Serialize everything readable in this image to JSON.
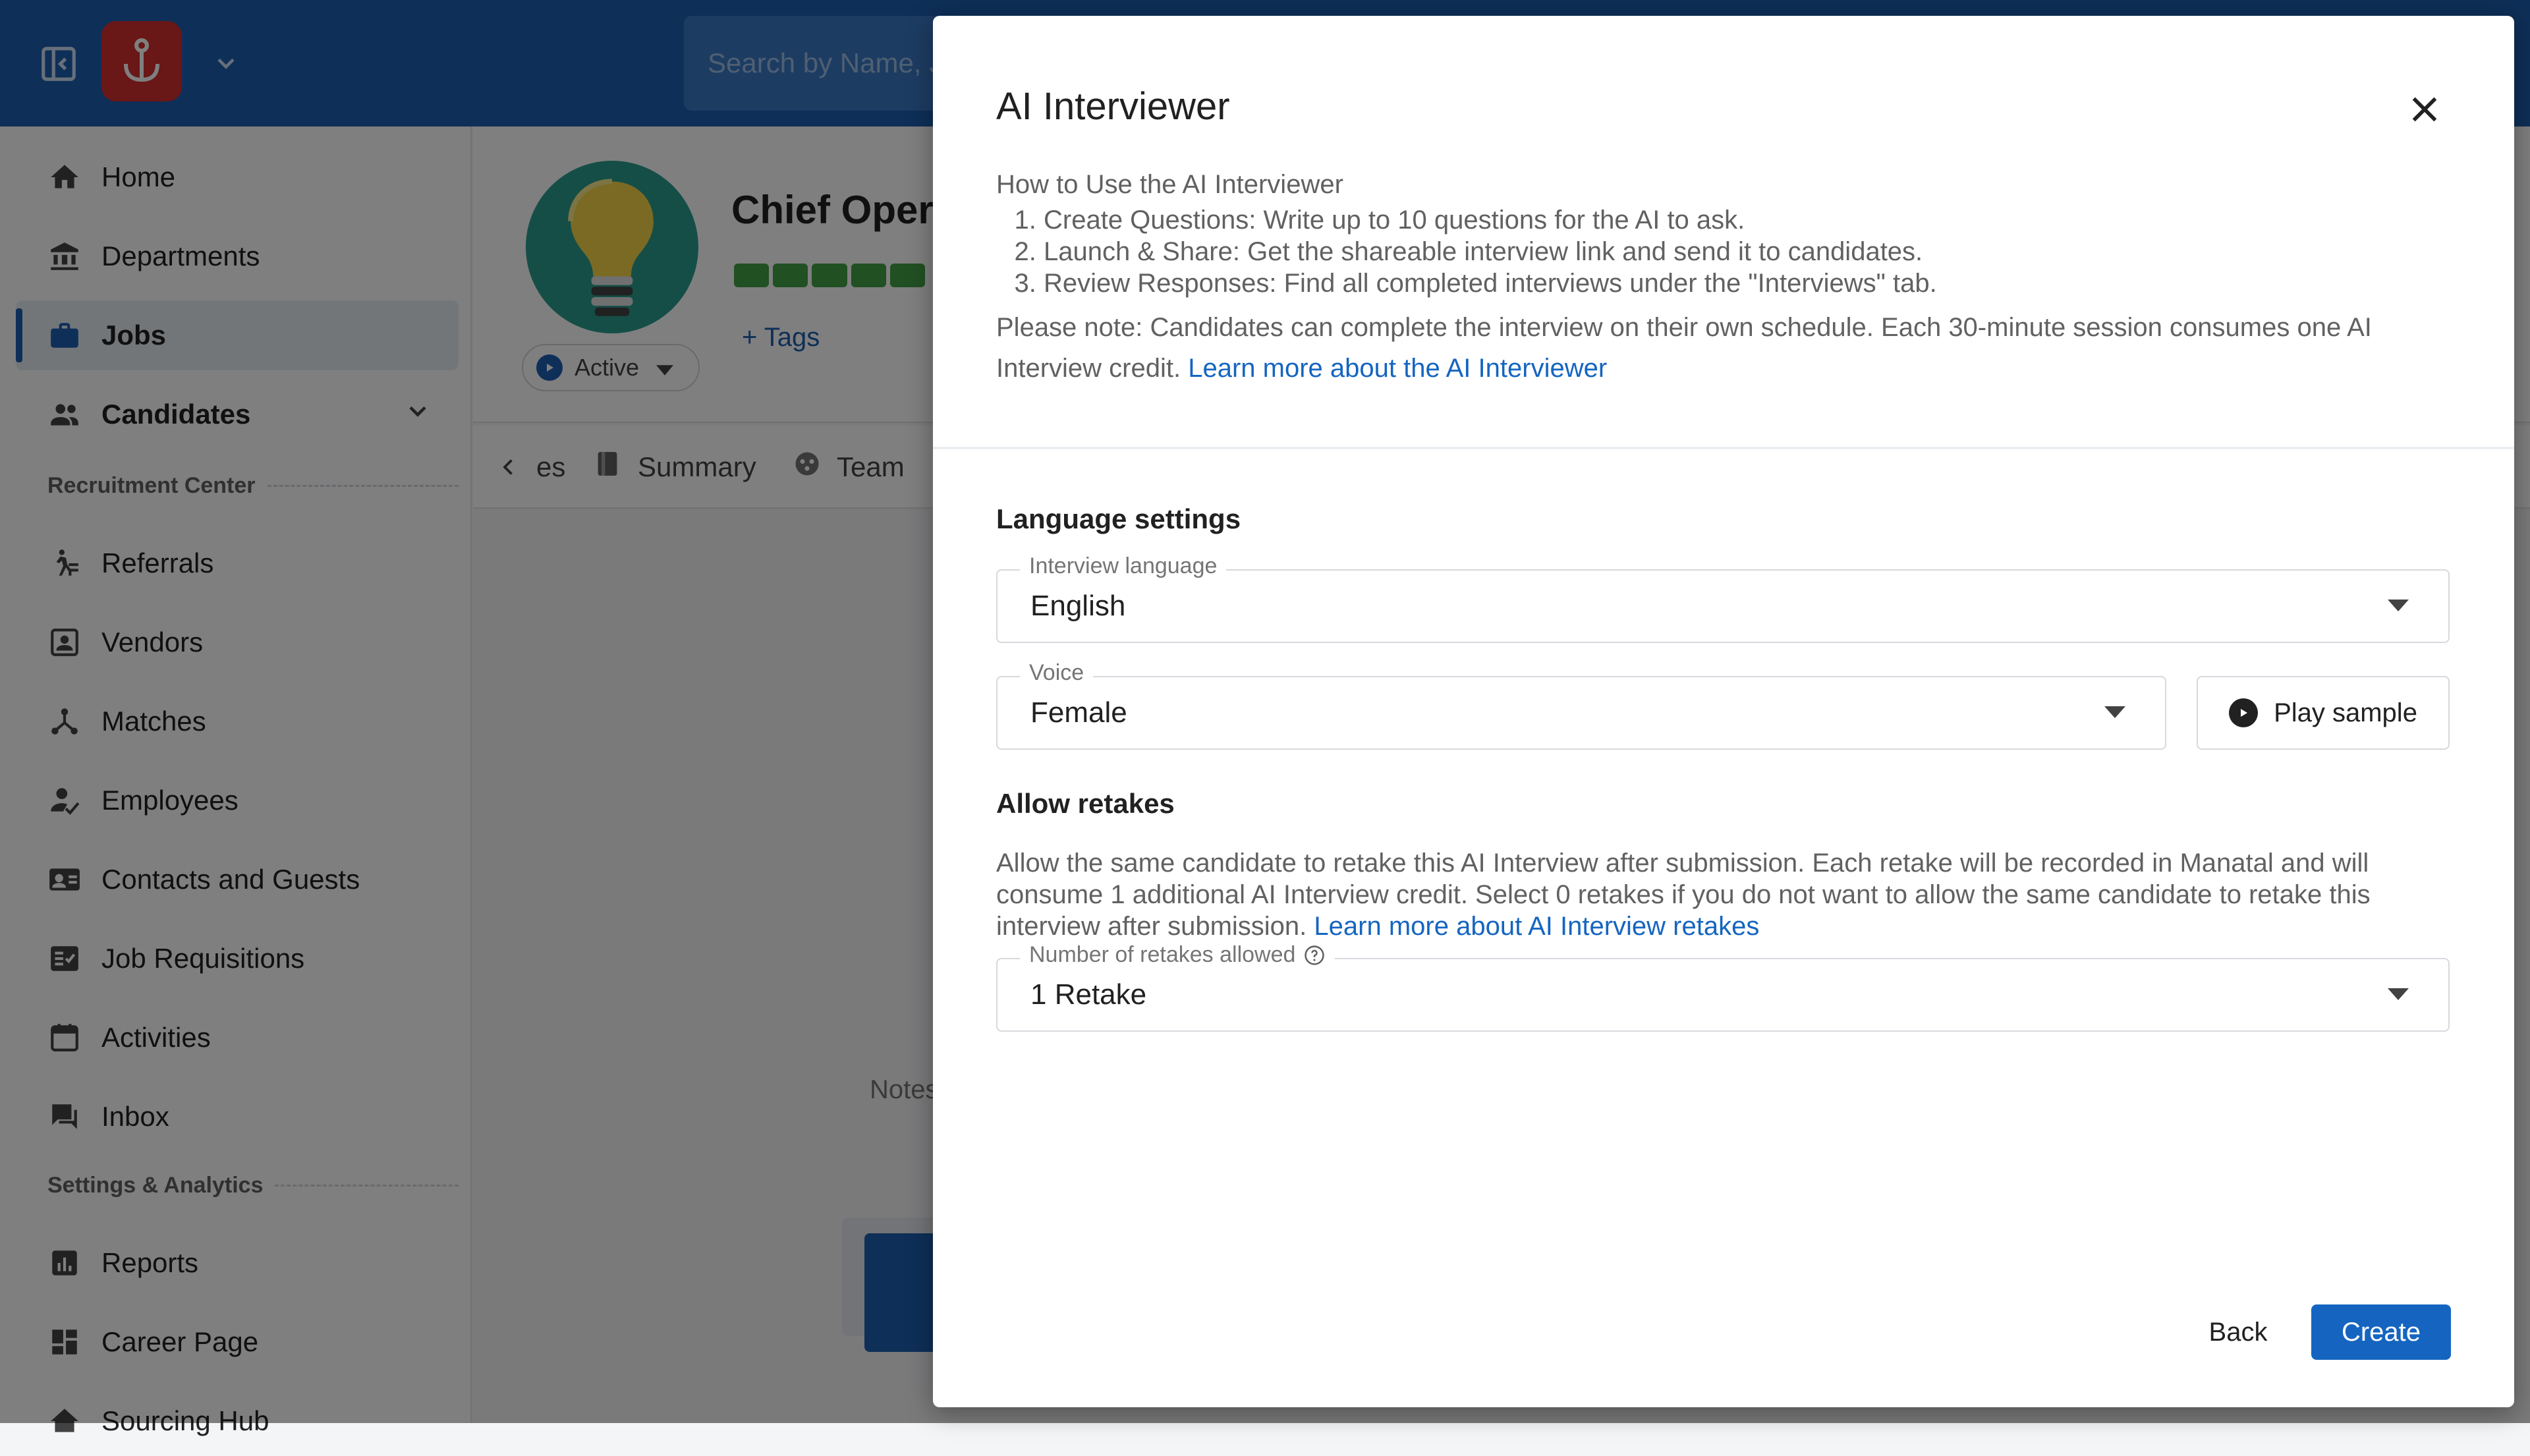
{
  "topbar": {
    "search_placeholder": "Search by Name, J"
  },
  "sidebar": {
    "items": [
      {
        "label": "Home",
        "icon": "home-icon"
      },
      {
        "label": "Departments",
        "icon": "bank-icon"
      },
      {
        "label": "Jobs",
        "icon": "briefcase-icon"
      },
      {
        "label": "Candidates",
        "icon": "people-icon"
      },
      {
        "label": "Referrals",
        "icon": "referral-icon"
      },
      {
        "label": "Vendors",
        "icon": "vendor-icon"
      },
      {
        "label": "Matches",
        "icon": "matches-icon"
      },
      {
        "label": "Employees",
        "icon": "employee-icon"
      },
      {
        "label": "Contacts and Guests",
        "icon": "contact-card-icon"
      },
      {
        "label": "Job Requisitions",
        "icon": "requisition-icon"
      },
      {
        "label": "Activities",
        "icon": "calendar-icon"
      },
      {
        "label": "Inbox",
        "icon": "inbox-icon"
      },
      {
        "label": "Reports",
        "icon": "reports-icon"
      },
      {
        "label": "Career Page",
        "icon": "dashboard-icon"
      },
      {
        "label": "Sourcing Hub",
        "icon": "sourcing-icon"
      }
    ],
    "sections": {
      "recruitment": "Recruitment Center",
      "settings": "Settings & Analytics"
    }
  },
  "job": {
    "title": "Chief Opera",
    "status": "Active",
    "tags_label": "+ Tags",
    "tabs": [
      "es",
      "Summary",
      "Team"
    ],
    "notes_label": "Notes"
  },
  "modal": {
    "title": "AI Interviewer",
    "howto_title": "How to Use the AI Interviewer",
    "steps": [
      "Create Questions: Write up to 10 questions for the AI to ask.",
      "Launch & Share: Get the shareable interview link and send it to candidates.",
      "Review Responses: Find all completed interviews under the \"Interviews\" tab."
    ],
    "note": "Please note: Candidates can complete the interview on their own schedule. Each 30-minute session consumes one AI Interview credit.",
    "note_link": "Learn more about the AI Interviewer",
    "language_section": "Language settings",
    "language_field": {
      "label": "Interview language",
      "value": "English"
    },
    "voice_field": {
      "label": "Voice",
      "value": "Female"
    },
    "play_sample": "Play sample",
    "retakes_section": "Allow retakes",
    "retakes_desc": "Allow the same candidate to retake this AI Interview after submission. Each retake will be recorded in Manatal and will consume 1 additional AI Interview credit. Select 0 retakes if you do not want to allow the same candidate to retake this interview after submission.",
    "retakes_link": "Learn more about AI Interview retakes",
    "retakes_field": {
      "label": "Number of retakes allowed",
      "value": "1 Retake"
    },
    "back": "Back",
    "create": "Create"
  },
  "colors": {
    "brand": "#1d5fb0",
    "logo": "#d32f2f",
    "primary_button": "#1565c0",
    "link": "#1565c0",
    "progress": "#43a047"
  }
}
